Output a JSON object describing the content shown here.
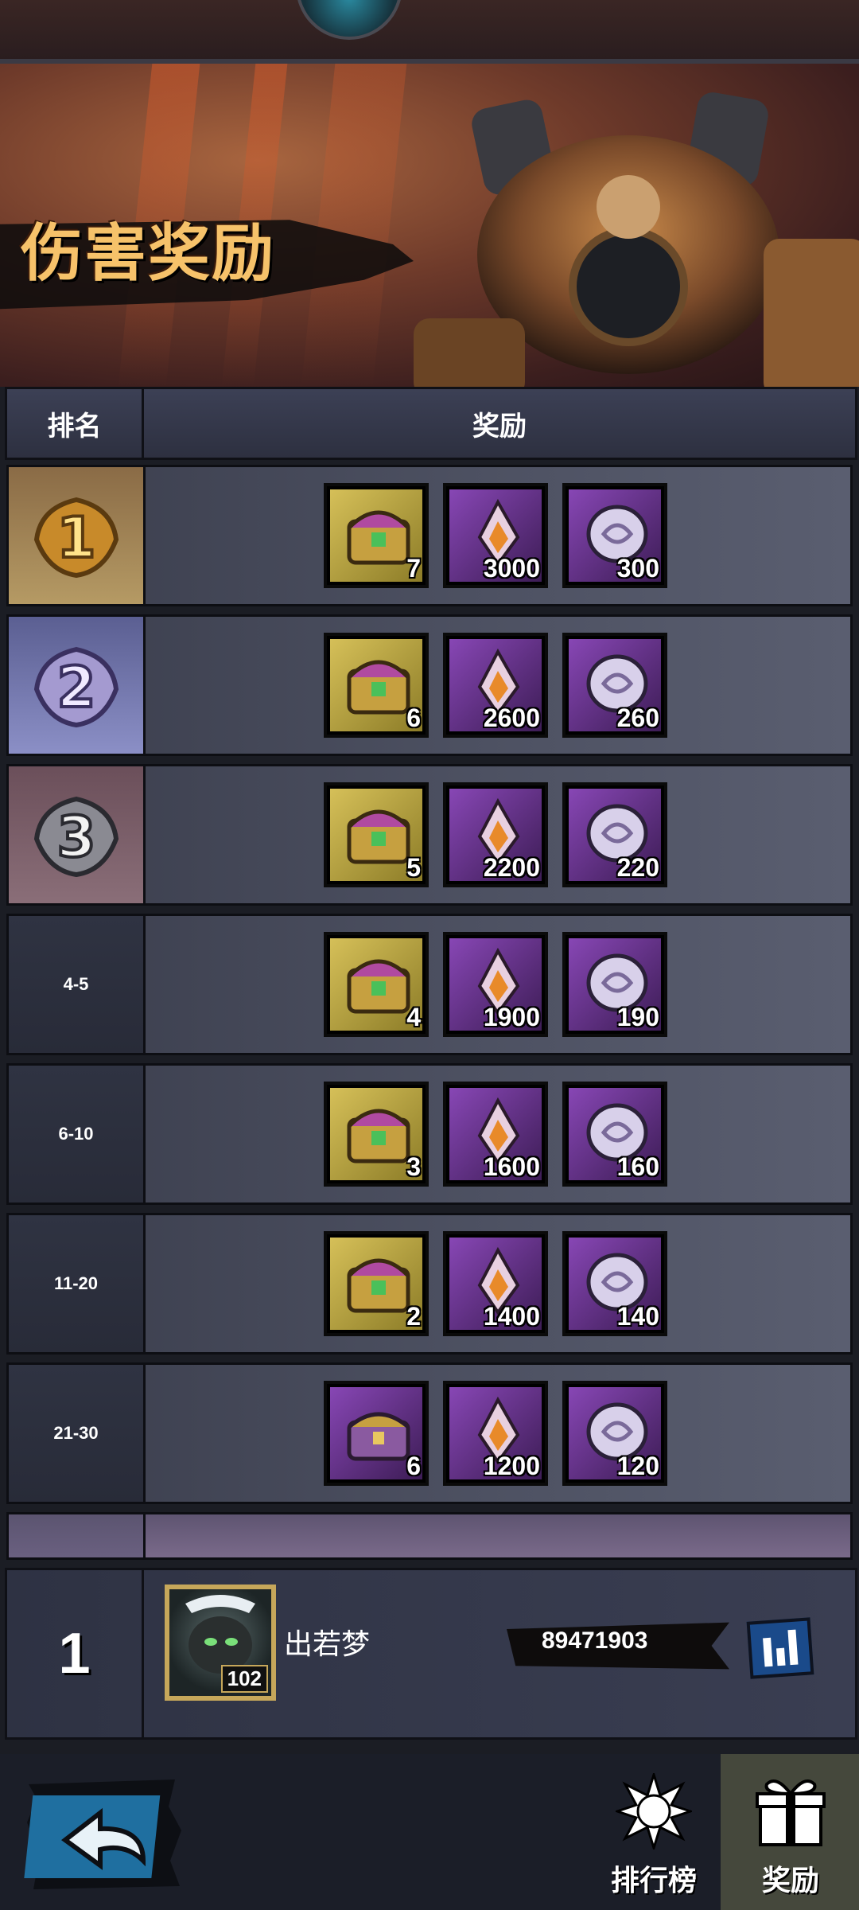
{
  "banner": {
    "title": "伤害奖励"
  },
  "table_header": {
    "rank": "排名",
    "reward": "奖励"
  },
  "rows": [
    {
      "rank": "1",
      "rewards": [
        {
          "icon": "gold-chest-icon",
          "count": "7"
        },
        {
          "icon": "crystal-shard-icon",
          "count": "3000"
        },
        {
          "icon": "silver-coin-icon",
          "count": "300"
        }
      ]
    },
    {
      "rank": "2",
      "rewards": [
        {
          "icon": "gold-chest-icon",
          "count": "6"
        },
        {
          "icon": "crystal-shard-icon",
          "count": "2600"
        },
        {
          "icon": "silver-coin-icon",
          "count": "260"
        }
      ]
    },
    {
      "rank": "3",
      "rewards": [
        {
          "icon": "gold-chest-icon",
          "count": "5"
        },
        {
          "icon": "crystal-shard-icon",
          "count": "2200"
        },
        {
          "icon": "silver-coin-icon",
          "count": "220"
        }
      ]
    },
    {
      "rank": "4-5",
      "rewards": [
        {
          "icon": "gold-chest-icon",
          "count": "4"
        },
        {
          "icon": "crystal-shard-icon",
          "count": "1900"
        },
        {
          "icon": "silver-coin-icon",
          "count": "190"
        }
      ]
    },
    {
      "rank": "6-10",
      "rewards": [
        {
          "icon": "gold-chest-icon",
          "count": "3"
        },
        {
          "icon": "crystal-shard-icon",
          "count": "1600"
        },
        {
          "icon": "silver-coin-icon",
          "count": "160"
        }
      ]
    },
    {
      "rank": "11-20",
      "rewards": [
        {
          "icon": "gold-chest-icon",
          "count": "2"
        },
        {
          "icon": "crystal-shard-icon",
          "count": "1400"
        },
        {
          "icon": "silver-coin-icon",
          "count": "140"
        }
      ]
    },
    {
      "rank": "21-30",
      "rewards": [
        {
          "icon": "purple-chest-icon",
          "count": "6"
        },
        {
          "icon": "crystal-shard-icon",
          "count": "1200"
        },
        {
          "icon": "silver-coin-icon",
          "count": "120"
        }
      ]
    }
  ],
  "my_rank": {
    "rank": "1",
    "level": "102",
    "name": "出若梦",
    "score": "89471903"
  },
  "bottom_tabs": {
    "ranking": "排行榜",
    "reward": "奖励"
  },
  "colors": {
    "gold_frame": "#d8c25a",
    "purple_frame": "#8a48b8",
    "title": "#f6c26a"
  }
}
